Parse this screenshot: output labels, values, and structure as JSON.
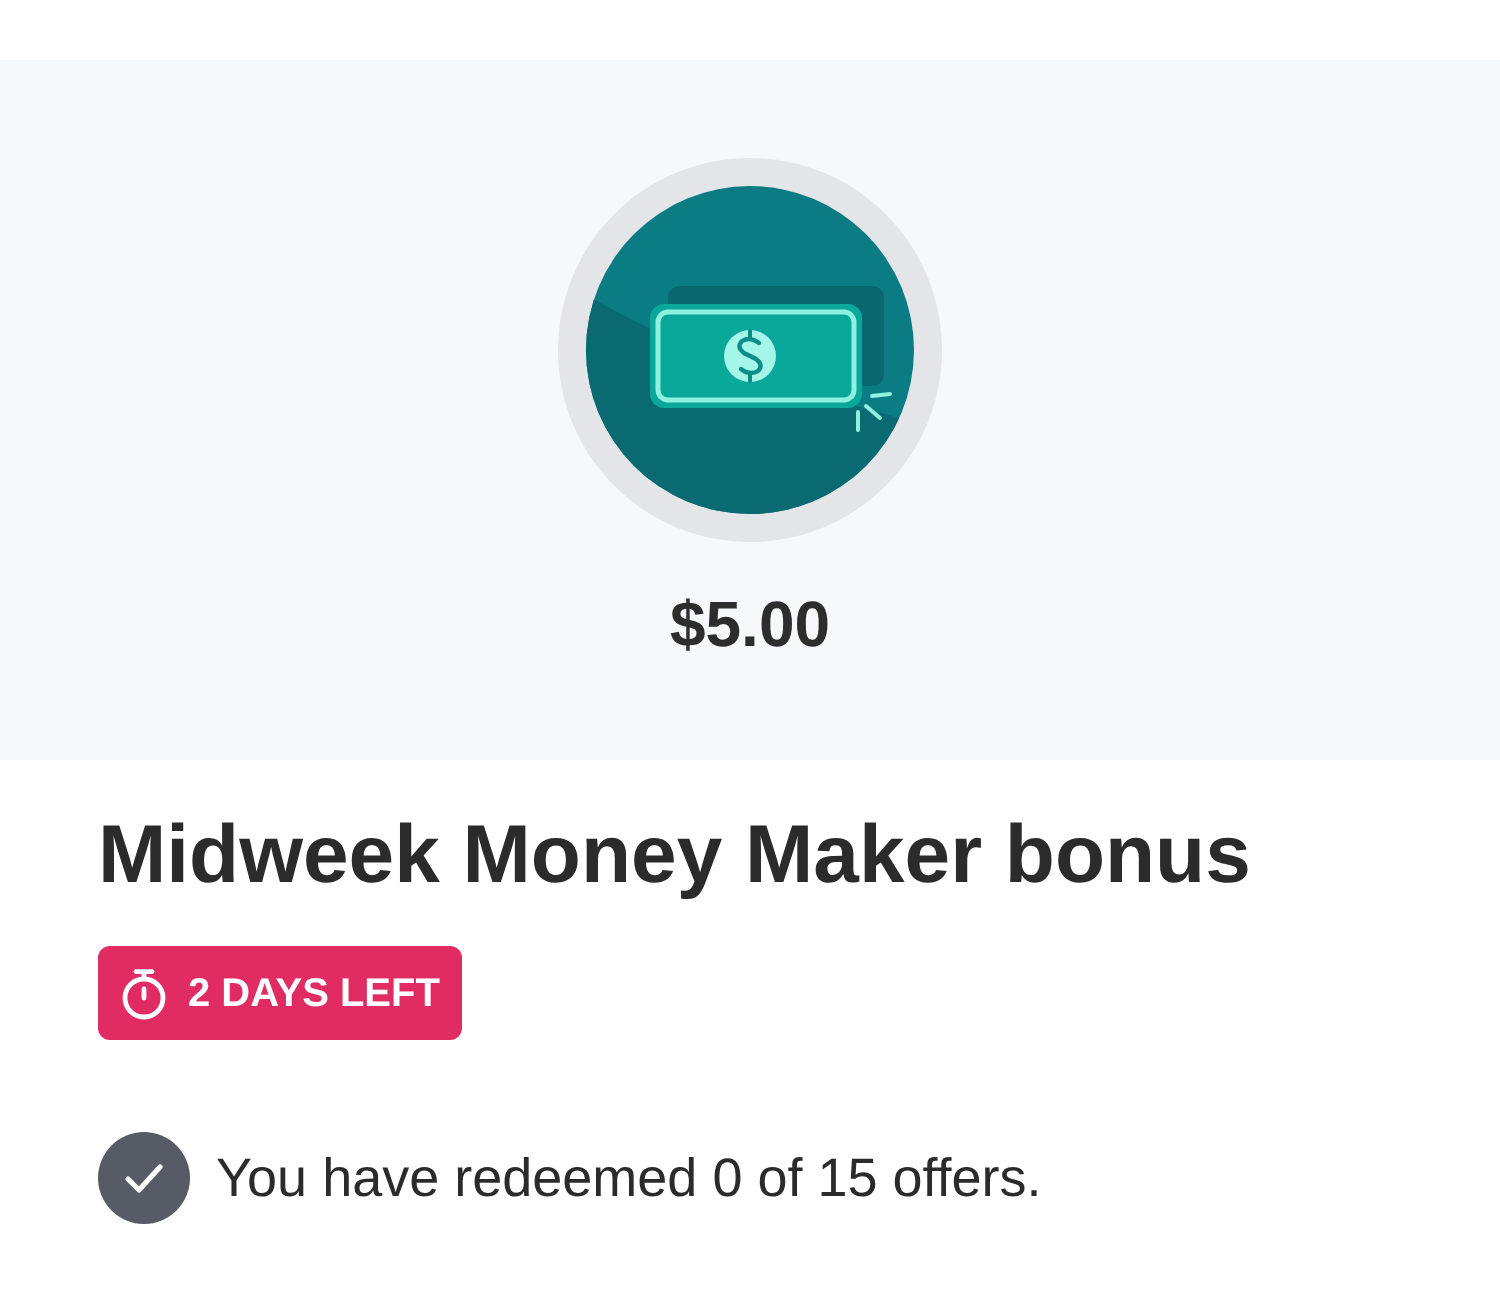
{
  "reward": {
    "amount": "$5.00"
  },
  "title": "Midweek Money Maker bonus",
  "badge": {
    "text": "2 DAYS LEFT"
  },
  "progress": {
    "text": "You have redeemed 0 of 15 offers."
  }
}
